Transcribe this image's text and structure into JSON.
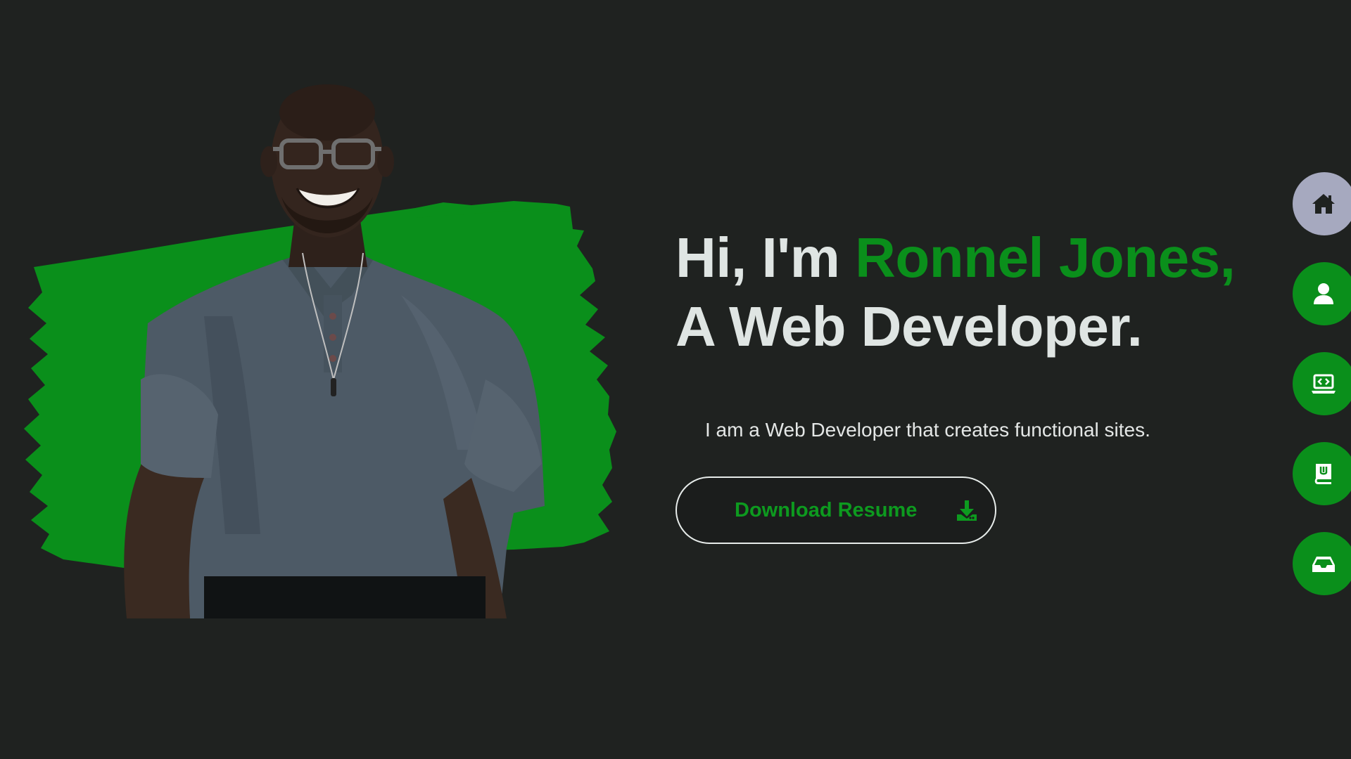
{
  "hero": {
    "image_alt": "Portrait of a smiling man in glasses and a gray polo shirt over a green brush stroke",
    "brush_color": "#0a8f1b"
  },
  "intro": {
    "greeting": "Hi, I'm ",
    "name": "Ronnel Jones,",
    "role": "A Web Developer.",
    "tagline": "I am a Web Developer that creates functional sites."
  },
  "resume_button": {
    "label": "Download Resume",
    "icon": "download-icon"
  },
  "side_nav": {
    "items": [
      {
        "icon": "home-icon",
        "active": true
      },
      {
        "icon": "user-icon",
        "active": false
      },
      {
        "icon": "laptop-code-icon",
        "active": false
      },
      {
        "icon": "book-icon",
        "active": false
      },
      {
        "icon": "inbox-icon",
        "active": false
      }
    ]
  },
  "colors": {
    "background": "#1f2220",
    "accent": "#0a8f1b",
    "text": "#dfe5e3",
    "nav_active": "#a6a9bf"
  }
}
